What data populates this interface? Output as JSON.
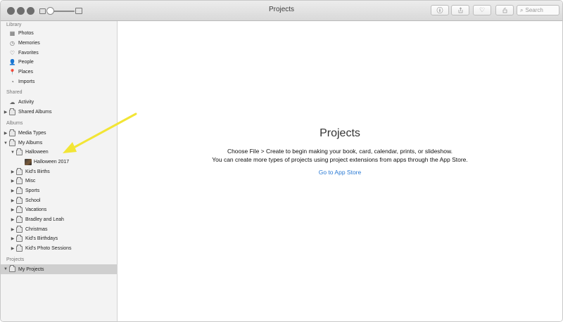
{
  "window": {
    "title": "Projects"
  },
  "toolbar": {
    "info_icon": "info-icon",
    "share_icon": "share-icon",
    "heart_icon": "heart-icon",
    "rotate_icon": "rotate-icon",
    "search_placeholder": "Search"
  },
  "sidebar": {
    "library_head": "Library",
    "library": [
      "Photos",
      "Memories",
      "Favorites",
      "People",
      "Places",
      "Imports"
    ],
    "shared_head": "Shared",
    "shared": [
      "Activity",
      "Shared Albums"
    ],
    "albums_head": "Albums",
    "albums": [
      "Media Types",
      "My Albums"
    ],
    "my_albums": {
      "halloween": "Halloween",
      "halloween_child": "Halloween 2017",
      "others": [
        "Kid's Births",
        "Misc",
        "Sports",
        "School",
        "Vacations",
        "Bradley and Leah",
        "Christmas",
        "Kid's Birthdays",
        "Kid's Photo Sessions"
      ]
    },
    "projects_head": "Projects",
    "projects": [
      "My Projects"
    ]
  },
  "main": {
    "title": "Projects",
    "line1": "Choose File > Create to begin making your book, card, calendar, prints, or slideshow.",
    "line2": "You can create more types of projects using project extensions from apps through the App Store.",
    "link": "Go to App Store"
  },
  "colors": {
    "link": "#2a7ad4",
    "arrow": "#f2e535",
    "selected_row": "#cfcfcf"
  }
}
